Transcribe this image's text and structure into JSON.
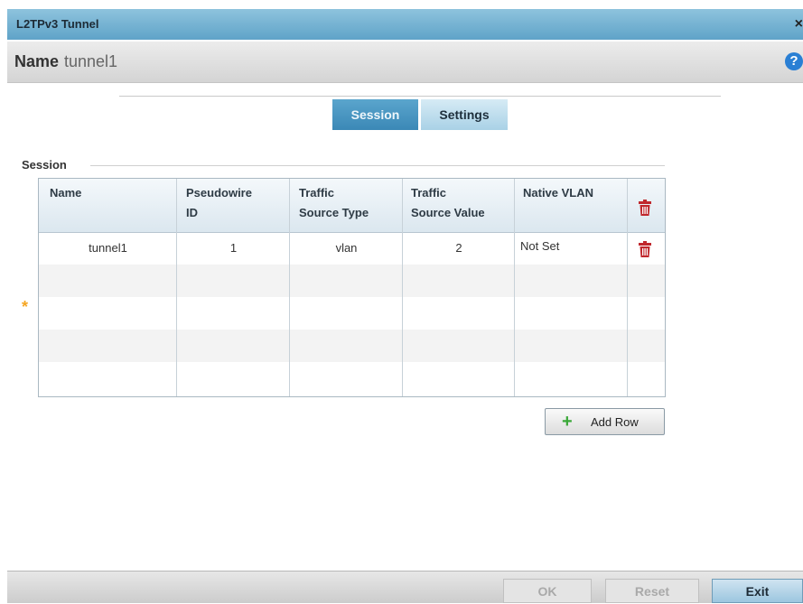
{
  "window": {
    "title": "L2TPv3 Tunnel",
    "close_label": "×"
  },
  "name_bar": {
    "label": "Name",
    "value": "tunnel1",
    "help_label": "?"
  },
  "tabs": [
    {
      "label": "Session",
      "active": true
    },
    {
      "label": "Settings",
      "active": false
    }
  ],
  "section": {
    "title": "Session"
  },
  "table": {
    "headers": {
      "name": "Name",
      "pseudowire_1": "Pseudowire",
      "pseudowire_2": "ID",
      "traffic_type_1": "Traffic",
      "traffic_type_2": "Source Type",
      "traffic_value_1": "Traffic",
      "traffic_value_2": "Source Value",
      "native_vlan": "Native VLAN"
    },
    "rows": [
      {
        "name": "tunnel1",
        "pseudowire_id": "1",
        "traffic_source_type": "vlan",
        "traffic_source_value": "2",
        "native_vlan": "Not Set"
      }
    ],
    "required_marker": "*"
  },
  "add_row": {
    "icon": "plus-icon",
    "label": "Add Row"
  },
  "footer": {
    "ok": "OK",
    "reset": "Reset",
    "exit": "Exit"
  },
  "colors": {
    "accent": "#3b88b6",
    "trash": "#c0282d",
    "add": "#3aa838",
    "required": "#f5a623"
  }
}
